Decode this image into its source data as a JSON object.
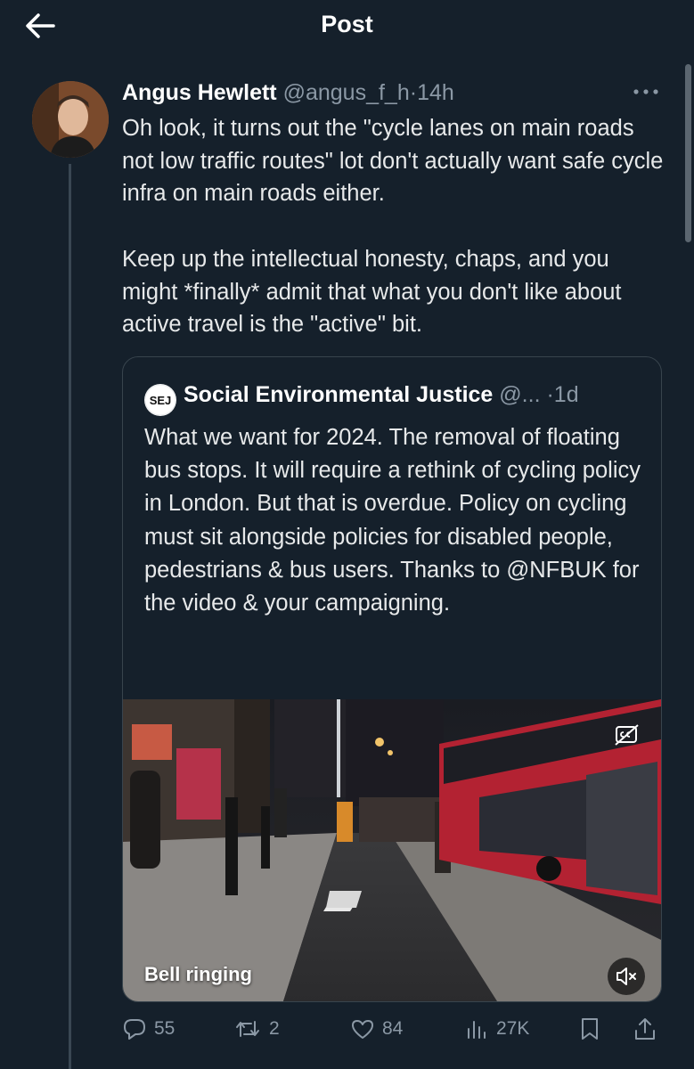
{
  "topbar": {
    "title": "Post"
  },
  "post": {
    "author": "Angus Hewlett",
    "handle": "@angus_f_h",
    "separator": "·",
    "time": "14h",
    "paragraphs": [
      "Oh look, it turns out the \"cycle lanes on main roads not low traffic routes\" lot don't actually want safe cycle infra on main roads either.",
      "Keep up the intellectual honesty, chaps, and you might *finally* admit that what you don't like about active travel is the \"active\" bit."
    ]
  },
  "quote": {
    "name": "Social Environmental Justice",
    "logo_text": "SEJ",
    "handle": "@...",
    "separator": "·",
    "time": "1d",
    "text": "What we want for 2024. The removal of floating bus stops. It will require a rethink of cycling policy in London. But that is overdue. Policy on cycling must sit alongside policies for disabled people, pedestrians & bus users. Thanks to @NFBUK for the video & your campaigning.",
    "video": {
      "caption": "Bell ringing",
      "muted": true
    }
  },
  "actions": {
    "replies": "55",
    "reposts": "2",
    "likes": "84",
    "views": "27K"
  },
  "colors": {
    "background": "#15202b",
    "text": "#e7e9ea",
    "muted": "#8b98a5",
    "border": "#38444d"
  }
}
